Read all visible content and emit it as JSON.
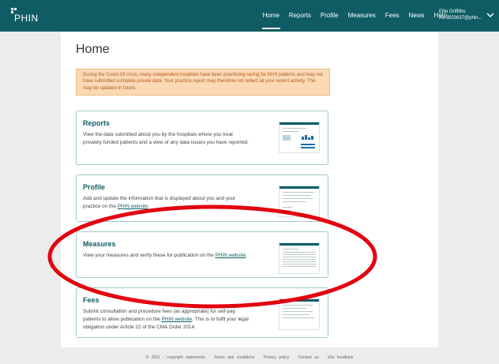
{
  "brand": {
    "name": "PHIN"
  },
  "nav": {
    "items": [
      "Home",
      "Reports",
      "Profile",
      "Measures",
      "Fees",
      "News",
      "Help"
    ],
    "active": "Home"
  },
  "user": {
    "name": "Ellie Griffiths",
    "account": "As 3503637@phin..."
  },
  "page": {
    "title": "Home",
    "notice": "During the Covid-19 crisis, many independent hospitals have been prioritising caring for NHS patients and may not have submitted complete private data. Your practice report may therefore not reflect all your recent activity. This may be updated in future."
  },
  "cards": [
    {
      "title": "Reports",
      "desc": "View the data submitted about you by the hospitals where you treat privately funded patients and a view of any data issues you have reported."
    },
    {
      "title": "Profile",
      "desc_before": "Add and update the information that is displayed about you and your practice on the ",
      "link": "PHIN website",
      "desc_after": "."
    },
    {
      "title": "Measures",
      "desc_before": "View your measures and verify these for publication on the ",
      "link": "PHIN website",
      "desc_after": "."
    },
    {
      "title": "Fees",
      "desc_before": "Submit consultation and procedure fees (as appropriate) for self-pay patients to allow publication on the ",
      "link": "PHIN website",
      "desc_after": ". This is to fulfil your legal obligation under Article 22 of the CMA Order 2014."
    }
  ],
  "footer": {
    "copyright": "© 2021 - copyright statements",
    "links": [
      "Terms and conditions",
      "Privacy policy",
      "Contact us",
      "Site feedback"
    ]
  },
  "colors": {
    "brand": "#0f5c64",
    "notice_bg": "#fbd9b5",
    "annotation": "#e3000f"
  }
}
